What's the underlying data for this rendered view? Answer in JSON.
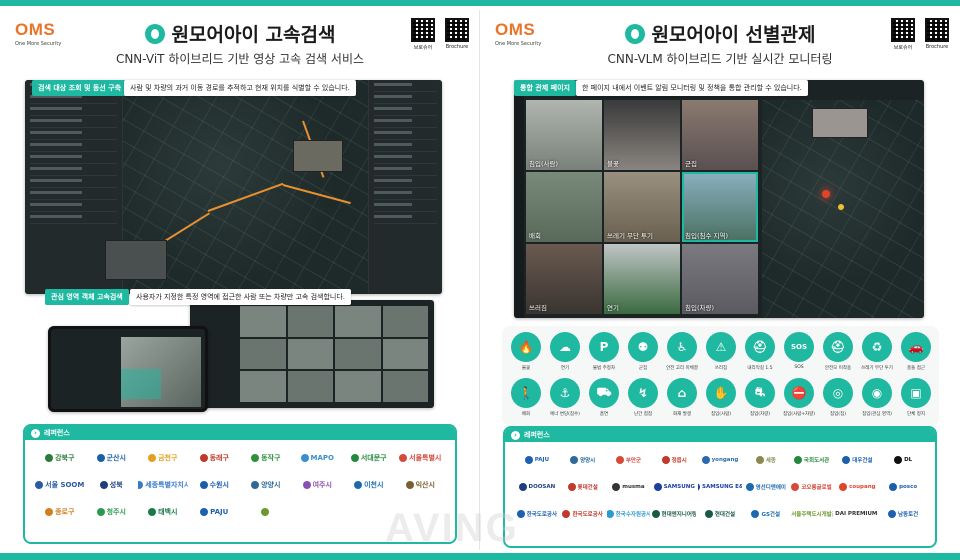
{
  "left": {
    "logo": "OMS",
    "logo_sub": "One More Security",
    "title": "원모어아이 고속검색",
    "subtitle": "CNN-ViT 하이브리드 기반 영상 고속 검색 서비스",
    "qr_labels": [
      "브로슈어",
      "Brochure"
    ],
    "tag1": "검색 대상 조회 및 동선 구축",
    "caption1": "사람 및 차량의 과거 이동 경로를 추적하고 현재 위치를 식별할 수 있습니다.",
    "tag2": "관심 영역 객체 고속검색",
    "caption2": "사용자가 지정한 특정 영역에 접근한 사람 또는 차량만 고속 검색합니다.",
    "ref_title": "레퍼런스",
    "references": [
      {
        "name": "강북구",
        "color": "#2c7a3a"
      },
      {
        "name": "군산시",
        "color": "#1b5fa8"
      },
      {
        "name": "금천구",
        "color": "#e0a020"
      },
      {
        "name": "동래구",
        "color": "#c0392b"
      },
      {
        "name": "동작구",
        "color": "#2f8f3e"
      },
      {
        "name": "MAPO",
        "color": "#3a8fd0"
      },
      {
        "name": "서대문구",
        "color": "#238a3c"
      },
      {
        "name": "서울특별시",
        "color": "#d64a3b"
      },
      {
        "name": "서울 SOOM",
        "color": "#2a5aa0"
      },
      {
        "name": "성북",
        "color": "#1d3f80"
      },
      {
        "name": "세종특별자치시",
        "color": "#3a7ac8"
      },
      {
        "name": "수원시",
        "color": "#1b5fa8"
      },
      {
        "name": "양양시",
        "color": "#2d6a9a"
      },
      {
        "name": "여주시",
        "color": "#8a4fb0"
      },
      {
        "name": "이천시",
        "color": "#1b6ab0"
      },
      {
        "name": "익산시",
        "color": "#7a6030"
      },
      {
        "name": "종로구",
        "color": "#d08020"
      },
      {
        "name": "청주시",
        "color": "#2a9a50"
      },
      {
        "name": "태백시",
        "color": "#1a7a4a"
      },
      {
        "name": "PAJU",
        "color": "#1d60b0"
      },
      {
        "name": "",
        "color": "#6a9a2a"
      }
    ]
  },
  "right": {
    "logo": "OMS",
    "logo_sub": "One More Security",
    "title": "원모어아이 선별관제",
    "subtitle": "CNN-VLM 하이브리드 기반 실시간 모니터링",
    "qr_labels": [
      "브로슈어",
      "Brochure"
    ],
    "tag1": "통합 관제 페이지",
    "caption1": "한 페이지 내에서 이벤트 알림 모니터링 및 정책을 통합 관리할 수 있습니다.",
    "cells": [
      "침입(사람)",
      "불꽃",
      "군집",
      "배회",
      "쓰레기 무단 투기",
      "침입(침수 지역)",
      "쓰러짐",
      "연기",
      "침입(차량)"
    ],
    "icons": [
      {
        "glyph": "🔥",
        "label": "불꽃"
      },
      {
        "glyph": "☁",
        "label": "연기"
      },
      {
        "glyph": "P",
        "label": "불법 주정차"
      },
      {
        "glyph": "⚉",
        "label": "군집"
      },
      {
        "glyph": "♿",
        "label": "안전 고리 미체결"
      },
      {
        "glyph": "⚠",
        "label": "쓰러짐"
      },
      {
        "glyph": "⛑",
        "label": "내리막길 1.5"
      },
      {
        "glyph": "SOS",
        "label": "SOS"
      },
      {
        "glyph": "⛑",
        "label": "안전모 미착용"
      },
      {
        "glyph": "♻",
        "label": "쓰레기 무단 투기"
      },
      {
        "glyph": "🚗",
        "label": "충돌 접근"
      },
      {
        "glyph": "🚶",
        "label": "배회"
      },
      {
        "glyph": "⚓",
        "label": "에너 변당(침수)"
      },
      {
        "glyph": "⛟",
        "label": "흡연"
      },
      {
        "glyph": "↯",
        "label": "난간 접점"
      },
      {
        "glyph": "⌂",
        "label": "화재 발생"
      },
      {
        "glyph": "✋",
        "label": "침입(사람)"
      },
      {
        "glyph": "⛐",
        "label": "침입(차량)"
      },
      {
        "glyph": "⛔",
        "label": "침입(사람+차량)"
      },
      {
        "glyph": "◎",
        "label": "침입(칩)"
      },
      {
        "glyph": "◉",
        "label": "침입(관심 영역)"
      },
      {
        "glyph": "▣",
        "label": "단체 정지"
      }
    ],
    "ref_title": "레퍼런스",
    "references": [
      {
        "name": "PAJU",
        "color": "#1d60b0"
      },
      {
        "name": "양양시",
        "color": "#2d6a9a"
      },
      {
        "name": "부안군",
        "color": "#d64a3b"
      },
      {
        "name": "정읍시",
        "color": "#c0392b"
      },
      {
        "name": "yongang",
        "color": "#2a6ab0"
      },
      {
        "name": "세종",
        "color": "#8a8a50"
      },
      {
        "name": "국회도서관",
        "color": "#238a3c"
      },
      {
        "name": "대우건설",
        "color": "#1b5fa8"
      },
      {
        "name": "DL",
        "color": "#111111"
      },
      {
        "name": "DOOSAN",
        "color": "#1d3f80"
      },
      {
        "name": "롯데건설",
        "color": "#c0392b"
      },
      {
        "name": "musma",
        "color": "#333333"
      },
      {
        "name": "SAMSUNG",
        "color": "#1b3fa0"
      },
      {
        "name": "SAMSUNG E&A",
        "color": "#1b3fa0"
      },
      {
        "name": "영선디앤에이",
        "color": "#1b6ab0"
      },
      {
        "name": "코오롱글로벌",
        "color": "#d64a3b"
      },
      {
        "name": "coupang",
        "color": "#e0452b"
      },
      {
        "name": "posco",
        "color": "#1b5fa8"
      },
      {
        "name": "한국도로공사",
        "color": "#1d60b0"
      },
      {
        "name": "한국도로공사",
        "color": "#c0392b"
      },
      {
        "name": "한국수자원공사",
        "color": "#2a9ad0"
      },
      {
        "name": "현대엔지니어링",
        "color": "#1a5a40"
      },
      {
        "name": "현대건설",
        "color": "#1a5a40"
      },
      {
        "name": "GS건설",
        "color": "#1b6ab0"
      },
      {
        "name": "서울주택도시개발공사",
        "color": "#6a9a2a"
      },
      {
        "name": "HYUNDAI PREMIUM OUTLETS",
        "color": "#333333"
      },
      {
        "name": "남동토건",
        "color": "#1d60b0"
      }
    ]
  },
  "watermark": "AVING"
}
